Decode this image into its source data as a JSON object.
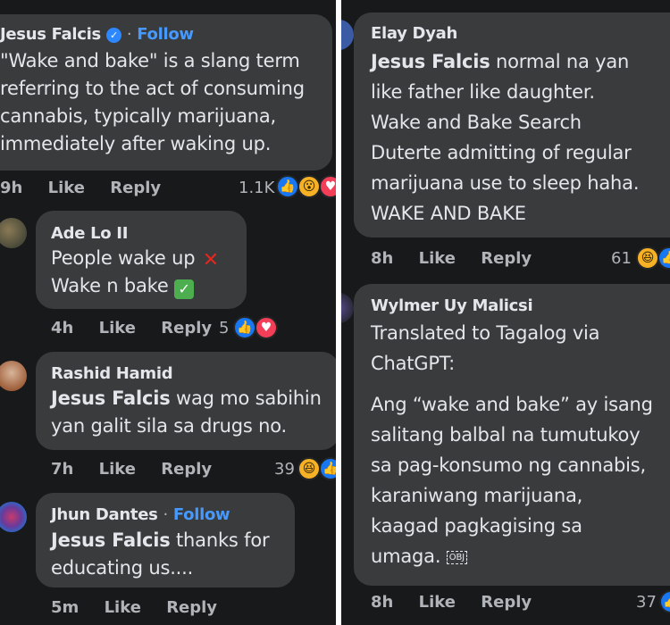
{
  "left": {
    "c1": {
      "author": "Jesus Falcis",
      "follow": "Follow",
      "lines": [
        "\"Wake and bake\" is a slang term",
        "referring to the act of consuming",
        "cannabis, typically marijuana,",
        "immediately after waking up."
      ],
      "time": "9h",
      "like": "Like",
      "reply": "Reply",
      "count": "1.1K"
    },
    "c2": {
      "author": "Ade Lo II",
      "line1": "People wake up",
      "line2": "Wake n bake",
      "time": "4h",
      "like": "Like",
      "reply": "Reply",
      "count": "5"
    },
    "c3": {
      "author": "Rashid Hamid",
      "mention": "Jesus Falcis",
      "line1": " wag mo sabihin",
      "line2": "yan galit sila sa drugs no.",
      "time": "7h",
      "like": "Like",
      "reply": "Reply",
      "count": "39"
    },
    "c4": {
      "author": "Jhun Dantes",
      "follow": "Follow",
      "mention": "Jesus Falcis",
      "line1": " thanks for",
      "line2": "educating us....",
      "time": "5m",
      "like": "Like",
      "reply": "Reply"
    }
  },
  "right": {
    "c1": {
      "author": "Elay Dyah",
      "mention": "Jesus Falcis",
      "line1": " normal na yan",
      "lines": [
        "like father like daughter.",
        "Wake and Bake Search",
        "Duterte admitting of regular",
        "marijuana use to sleep haha.",
        "WAKE AND BAKE"
      ],
      "time": "8h",
      "like": "Like",
      "reply": "Reply",
      "count": "61"
    },
    "c2": {
      "author": "Wylmer Uy Malicsi",
      "intro": [
        "Translated to Tagalog via",
        "ChatGPT:"
      ],
      "body": [
        "Ang “wake and bake” ay isang",
        "salitang balbal na tumutukoy",
        "sa pag-konsumo ng cannabis,",
        "karaniwang marijuana,",
        "kaagad pagkagising sa"
      ],
      "last": "umaga.",
      "obj": "OBJ",
      "time": "8h",
      "like": "Like",
      "reply": "Reply",
      "count": "37"
    }
  },
  "colors": {
    "bg": "#18191a",
    "bubble": "#3a3b3c",
    "text": "#e4e6eb",
    "muted": "#b0b3b8",
    "link": "#4599ff"
  }
}
